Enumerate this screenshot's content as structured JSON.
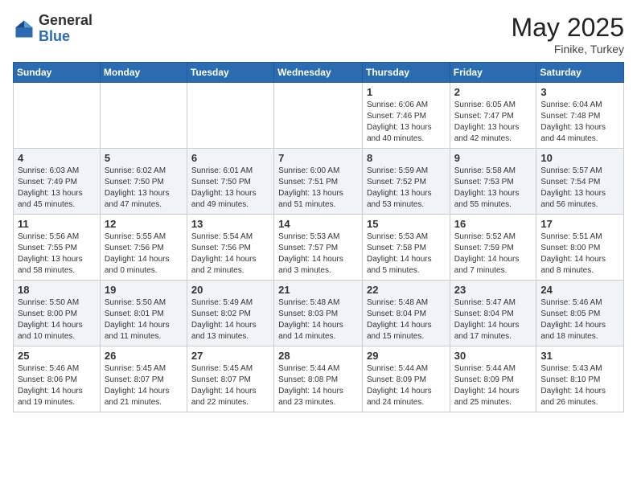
{
  "header": {
    "logo_general": "General",
    "logo_blue": "Blue",
    "month_year": "May 2025",
    "location": "Finike, Turkey"
  },
  "weekdays": [
    "Sunday",
    "Monday",
    "Tuesday",
    "Wednesday",
    "Thursday",
    "Friday",
    "Saturday"
  ],
  "weeks": [
    [
      {
        "day": "",
        "sunrise": "",
        "sunset": "",
        "daylight": ""
      },
      {
        "day": "",
        "sunrise": "",
        "sunset": "",
        "daylight": ""
      },
      {
        "day": "",
        "sunrise": "",
        "sunset": "",
        "daylight": ""
      },
      {
        "day": "",
        "sunrise": "",
        "sunset": "",
        "daylight": ""
      },
      {
        "day": "1",
        "sunrise": "Sunrise: 6:06 AM",
        "sunset": "Sunset: 7:46 PM",
        "daylight": "Daylight: 13 hours and 40 minutes."
      },
      {
        "day": "2",
        "sunrise": "Sunrise: 6:05 AM",
        "sunset": "Sunset: 7:47 PM",
        "daylight": "Daylight: 13 hours and 42 minutes."
      },
      {
        "day": "3",
        "sunrise": "Sunrise: 6:04 AM",
        "sunset": "Sunset: 7:48 PM",
        "daylight": "Daylight: 13 hours and 44 minutes."
      }
    ],
    [
      {
        "day": "4",
        "sunrise": "Sunrise: 6:03 AM",
        "sunset": "Sunset: 7:49 PM",
        "daylight": "Daylight: 13 hours and 45 minutes."
      },
      {
        "day": "5",
        "sunrise": "Sunrise: 6:02 AM",
        "sunset": "Sunset: 7:50 PM",
        "daylight": "Daylight: 13 hours and 47 minutes."
      },
      {
        "day": "6",
        "sunrise": "Sunrise: 6:01 AM",
        "sunset": "Sunset: 7:50 PM",
        "daylight": "Daylight: 13 hours and 49 minutes."
      },
      {
        "day": "7",
        "sunrise": "Sunrise: 6:00 AM",
        "sunset": "Sunset: 7:51 PM",
        "daylight": "Daylight: 13 hours and 51 minutes."
      },
      {
        "day": "8",
        "sunrise": "Sunrise: 5:59 AM",
        "sunset": "Sunset: 7:52 PM",
        "daylight": "Daylight: 13 hours and 53 minutes."
      },
      {
        "day": "9",
        "sunrise": "Sunrise: 5:58 AM",
        "sunset": "Sunset: 7:53 PM",
        "daylight": "Daylight: 13 hours and 55 minutes."
      },
      {
        "day": "10",
        "sunrise": "Sunrise: 5:57 AM",
        "sunset": "Sunset: 7:54 PM",
        "daylight": "Daylight: 13 hours and 56 minutes."
      }
    ],
    [
      {
        "day": "11",
        "sunrise": "Sunrise: 5:56 AM",
        "sunset": "Sunset: 7:55 PM",
        "daylight": "Daylight: 13 hours and 58 minutes."
      },
      {
        "day": "12",
        "sunrise": "Sunrise: 5:55 AM",
        "sunset": "Sunset: 7:56 PM",
        "daylight": "Daylight: 14 hours and 0 minutes."
      },
      {
        "day": "13",
        "sunrise": "Sunrise: 5:54 AM",
        "sunset": "Sunset: 7:56 PM",
        "daylight": "Daylight: 14 hours and 2 minutes."
      },
      {
        "day": "14",
        "sunrise": "Sunrise: 5:53 AM",
        "sunset": "Sunset: 7:57 PM",
        "daylight": "Daylight: 14 hours and 3 minutes."
      },
      {
        "day": "15",
        "sunrise": "Sunrise: 5:53 AM",
        "sunset": "Sunset: 7:58 PM",
        "daylight": "Daylight: 14 hours and 5 minutes."
      },
      {
        "day": "16",
        "sunrise": "Sunrise: 5:52 AM",
        "sunset": "Sunset: 7:59 PM",
        "daylight": "Daylight: 14 hours and 7 minutes."
      },
      {
        "day": "17",
        "sunrise": "Sunrise: 5:51 AM",
        "sunset": "Sunset: 8:00 PM",
        "daylight": "Daylight: 14 hours and 8 minutes."
      }
    ],
    [
      {
        "day": "18",
        "sunrise": "Sunrise: 5:50 AM",
        "sunset": "Sunset: 8:00 PM",
        "daylight": "Daylight: 14 hours and 10 minutes."
      },
      {
        "day": "19",
        "sunrise": "Sunrise: 5:50 AM",
        "sunset": "Sunset: 8:01 PM",
        "daylight": "Daylight: 14 hours and 11 minutes."
      },
      {
        "day": "20",
        "sunrise": "Sunrise: 5:49 AM",
        "sunset": "Sunset: 8:02 PM",
        "daylight": "Daylight: 14 hours and 13 minutes."
      },
      {
        "day": "21",
        "sunrise": "Sunrise: 5:48 AM",
        "sunset": "Sunset: 8:03 PM",
        "daylight": "Daylight: 14 hours and 14 minutes."
      },
      {
        "day": "22",
        "sunrise": "Sunrise: 5:48 AM",
        "sunset": "Sunset: 8:04 PM",
        "daylight": "Daylight: 14 hours and 15 minutes."
      },
      {
        "day": "23",
        "sunrise": "Sunrise: 5:47 AM",
        "sunset": "Sunset: 8:04 PM",
        "daylight": "Daylight: 14 hours and 17 minutes."
      },
      {
        "day": "24",
        "sunrise": "Sunrise: 5:46 AM",
        "sunset": "Sunset: 8:05 PM",
        "daylight": "Daylight: 14 hours and 18 minutes."
      }
    ],
    [
      {
        "day": "25",
        "sunrise": "Sunrise: 5:46 AM",
        "sunset": "Sunset: 8:06 PM",
        "daylight": "Daylight: 14 hours and 19 minutes."
      },
      {
        "day": "26",
        "sunrise": "Sunrise: 5:45 AM",
        "sunset": "Sunset: 8:07 PM",
        "daylight": "Daylight: 14 hours and 21 minutes."
      },
      {
        "day": "27",
        "sunrise": "Sunrise: 5:45 AM",
        "sunset": "Sunset: 8:07 PM",
        "daylight": "Daylight: 14 hours and 22 minutes."
      },
      {
        "day": "28",
        "sunrise": "Sunrise: 5:44 AM",
        "sunset": "Sunset: 8:08 PM",
        "daylight": "Daylight: 14 hours and 23 minutes."
      },
      {
        "day": "29",
        "sunrise": "Sunrise: 5:44 AM",
        "sunset": "Sunset: 8:09 PM",
        "daylight": "Daylight: 14 hours and 24 minutes."
      },
      {
        "day": "30",
        "sunrise": "Sunrise: 5:44 AM",
        "sunset": "Sunset: 8:09 PM",
        "daylight": "Daylight: 14 hours and 25 minutes."
      },
      {
        "day": "31",
        "sunrise": "Sunrise: 5:43 AM",
        "sunset": "Sunset: 8:10 PM",
        "daylight": "Daylight: 14 hours and 26 minutes."
      }
    ]
  ]
}
